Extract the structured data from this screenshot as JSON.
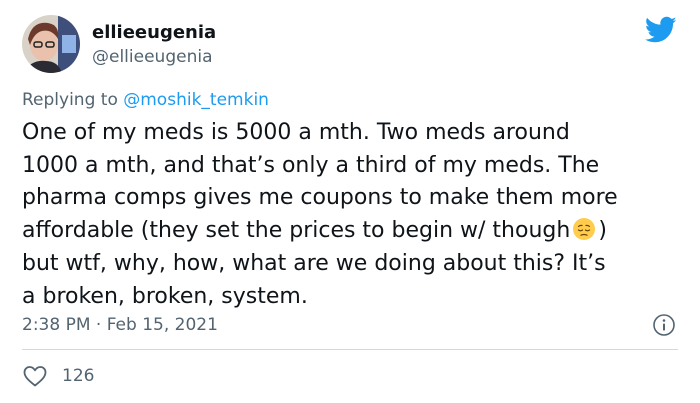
{
  "tweet": {
    "author": {
      "display_name": "ellieeugenia",
      "handle": "@ellieeugenia"
    },
    "reply": {
      "prefix": "Replying to ",
      "mention": "@moshik_temkin"
    },
    "text_lines": [
      "One of my meds is 5000 a mth. Two meds around",
      "1000 a mth, and that’s only a third of my meds. The",
      "pharma comps gives me coupons to make them more"
    ],
    "text_line4_before_emoji": "affordable (they set the prices to begin w/ though",
    "emoji": "pensive-face",
    "text_line4_after_emoji": ")",
    "text_lines_end": [
      "but wtf, why, how, what are we doing about this? It’s",
      "a broken, broken, system."
    ],
    "timestamp": "2:38 PM · Feb 15, 2021",
    "like_count": "126"
  },
  "icons": {
    "brand": "twitter-bird-icon",
    "info": "info-icon",
    "like": "heart-icon"
  },
  "colors": {
    "brand_blue": "#1d9bf0",
    "secondary_text": "#536471",
    "primary_text": "#0f1419",
    "divider": "#cfd9de"
  }
}
